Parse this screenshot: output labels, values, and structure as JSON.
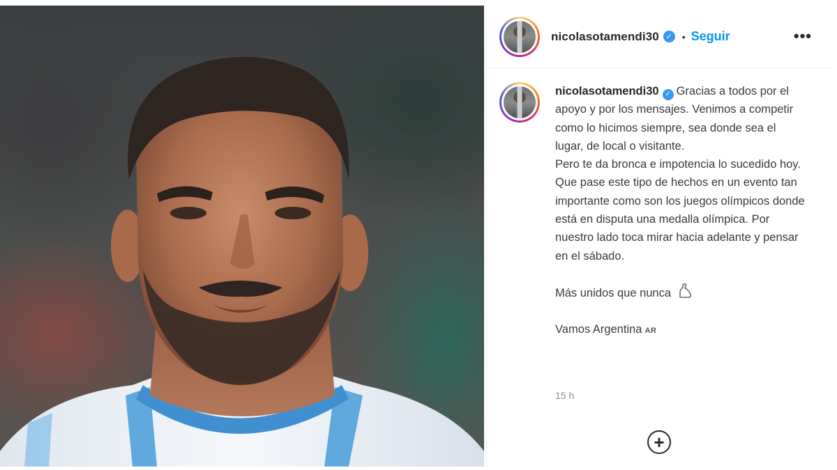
{
  "post": {
    "username": "nicolasotamendi30",
    "verified_glyph": "✓",
    "separator": "•",
    "follow_label": "Seguir",
    "more_glyph": "•••",
    "caption": {
      "username": "nicolasotamendi30",
      "paragraph_1": "Gracias a todos por el apoyo y por los mensajes. Venimos a competir como lo hicimos siempre, sea donde sea el lugar, de local o visitante.",
      "paragraph_2": "Pero te da bronca e impotencia lo sucedido hoy. Que pase este tipo de hechos en un evento tan importante como son los juegos olímpicos donde está en disputa una medalla olímpica. Por nuestro lado toca mirar hacia adelante y pensar en el sábado.",
      "paragraph_3": "Más unidos que nunca",
      "paragraph_4": "Vamos Argentina",
      "flag_text": "AR"
    },
    "timestamp": "15 h",
    "add_comment_glyph": "+"
  },
  "icons": {
    "verified": "verified-badge-icon",
    "more": "more-options-icon",
    "flexed_biceps": "flexed-biceps-icon",
    "add": "add-circle-icon"
  },
  "colors": {
    "follow_blue": "#0095f6",
    "verified_blue": "#3897f0",
    "text_dark": "#262626",
    "text_muted": "#8e8e8e"
  }
}
